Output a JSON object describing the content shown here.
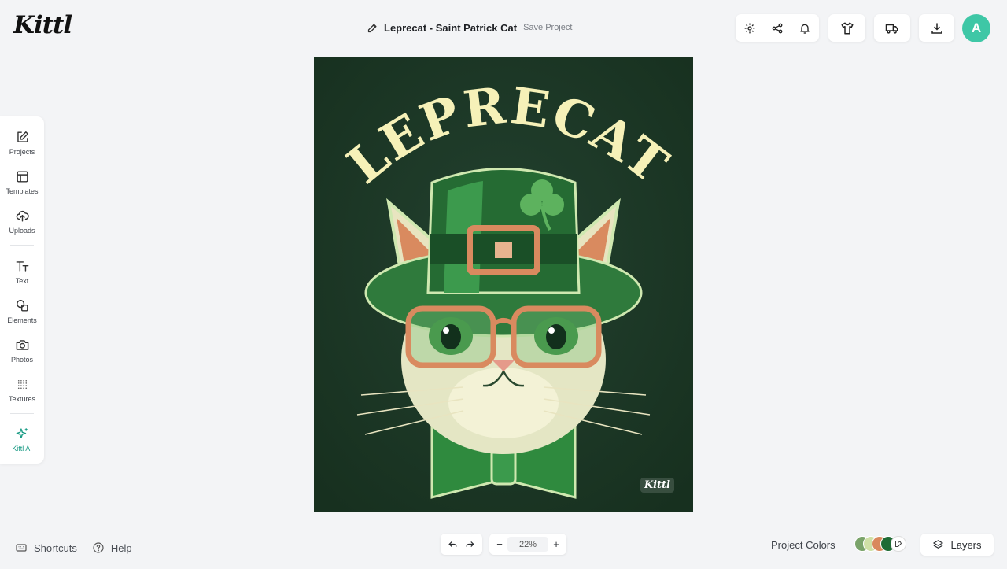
{
  "app": {
    "logo": "Kittl"
  },
  "header": {
    "title": "Leprecat - Saint Patrick Cat",
    "save_label": "Save Project"
  },
  "user": {
    "avatar_initial": "A"
  },
  "sidebar": {
    "items": [
      {
        "label": "Projects",
        "icon": "edit-icon"
      },
      {
        "label": "Templates",
        "icon": "template-icon"
      },
      {
        "label": "Uploads",
        "icon": "upload-cloud-icon"
      },
      {
        "label": "Text",
        "icon": "text-icon"
      },
      {
        "label": "Elements",
        "icon": "shapes-icon"
      },
      {
        "label": "Photos",
        "icon": "camera-icon"
      },
      {
        "label": "Textures",
        "icon": "texture-grid-icon"
      },
      {
        "label": "Kittl AI",
        "icon": "sparkle-icon"
      }
    ]
  },
  "artwork": {
    "headline": "LEPRECAT",
    "watermark": "Kittl",
    "colors": {
      "background": "#1b3628",
      "headline": "#f6f1b8",
      "hat": "#2f7a3c",
      "accent": "#d98a5f"
    }
  },
  "footer": {
    "shortcuts_label": "Shortcuts",
    "help_label": "Help",
    "zoom": "22%",
    "project_colors_label": "Project Colors",
    "project_colors": [
      "#7aa36a",
      "#cfe0a6",
      "#d9885d",
      "#1f6b34"
    ],
    "layers_label": "Layers"
  }
}
